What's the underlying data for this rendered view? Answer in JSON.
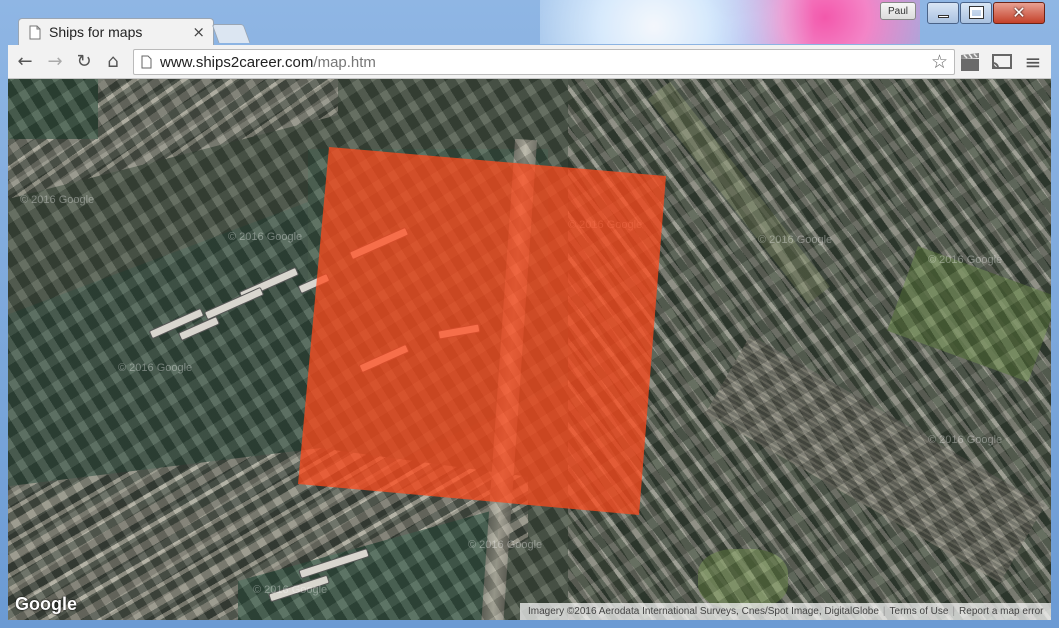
{
  "window": {
    "profile_name": "Paul",
    "close_glyph": "✕"
  },
  "tab": {
    "title": "Ships for maps",
    "close_glyph": "×"
  },
  "toolbar": {
    "back_glyph": "←",
    "forward_glyph": "→",
    "reload_glyph": "↻",
    "home_glyph": "⌂",
    "url_host": "www.ships2career.com",
    "url_path": "/map.htm",
    "star_glyph": "☆",
    "menu_glyph": "≡"
  },
  "map": {
    "watermark": "© 2016 Google",
    "logo": "Google",
    "attribution": "Imagery ©2016 Aerodata International Surveys, Cnes/Spot Image, DigitalGlobe",
    "terms_label": "Terms of Use",
    "report_label": "Report a map error",
    "overlay_color": "#ff4a1c",
    "overlay_opacity": 0.75
  },
  "colors": {
    "chrome_bg": "#f2f2f2",
    "window_frame": "#6b9ad3",
    "close_button": "#c4412a"
  }
}
